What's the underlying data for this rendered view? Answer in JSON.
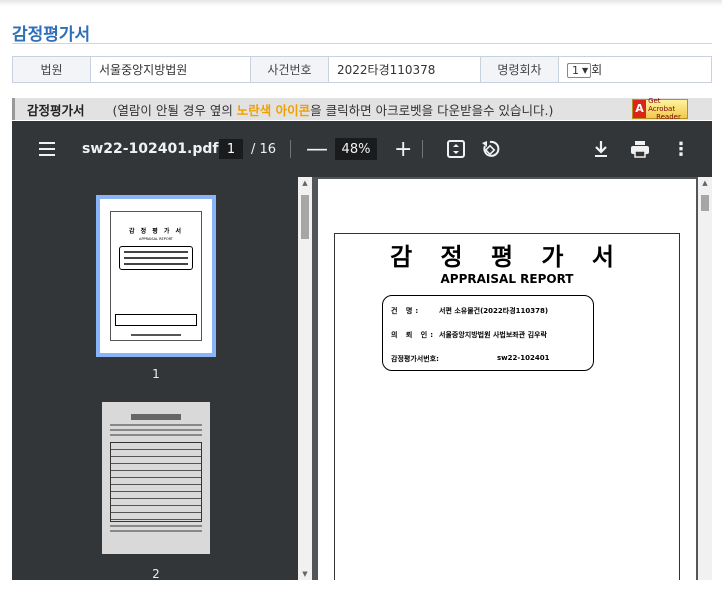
{
  "page_title": "감정평가서",
  "info_table": {
    "court_label": "법원",
    "court_value": "서울중앙지방법원",
    "case_label": "사건번호",
    "case_value": "2022타경110378",
    "order_label": "명령회차",
    "order_value": "1",
    "order_suffix": "회"
  },
  "appraisal_bar": {
    "title": "감정평가서",
    "note_before": "(열람이 안될 경우 옆의 ",
    "note_highlight": "노란색 아이콘",
    "note_after": "을 클릭하면 아크로벳을 다운받을수 있습니다.)",
    "acrobat_line1": "Get Acrobat",
    "acrobat_line2": "Reader",
    "acrobat_brand": "Adobe"
  },
  "viewer": {
    "filename": "sw22-102401.pdf",
    "current_page": "1",
    "total_pages": "/ 16",
    "zoom": "48%",
    "zoom_out_glyph": "—",
    "zoom_in_glyph": "+",
    "more_glyph": "⋮",
    "thumb1_label": "1",
    "thumb2_label": "2"
  },
  "document": {
    "title": "감 정 평 가 서",
    "subtitle": "APPRAISAL REPORT",
    "row1_key": "건 명:",
    "row1_value": "서편 소유물건(2022타경110378)",
    "row2_key": "의 뢰 인:",
    "row2_value": "서울중앙지방법원 사법보좌관 김우락",
    "row3_key": "감정평가서번호:",
    "row3_value": "sw22-102401"
  },
  "colors": {
    "title_blue": "#2f6fb8",
    "toolbar_bg": "#323639",
    "viewer_bg": "#525659",
    "thumb_highlight": "#8ab4f8"
  }
}
